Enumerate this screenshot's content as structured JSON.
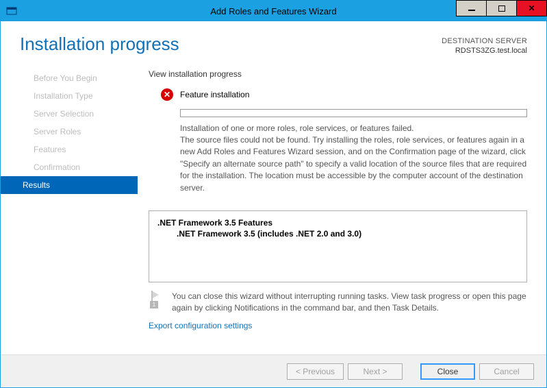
{
  "window": {
    "title": "Add Roles and Features Wizard"
  },
  "header": {
    "page_title": "Installation progress",
    "dest_label": "DESTINATION SERVER",
    "dest_name": "RDSTS3ZG.test.local"
  },
  "sidebar": {
    "items": [
      {
        "label": "Before You Begin"
      },
      {
        "label": "Installation Type"
      },
      {
        "label": "Server Selection"
      },
      {
        "label": "Server Roles"
      },
      {
        "label": "Features"
      },
      {
        "label": "Confirmation"
      },
      {
        "label": "Results"
      }
    ],
    "selected_index": 6
  },
  "main": {
    "section_title": "View installation progress",
    "status_text": "Feature installation",
    "message_line1": "Installation of one or more roles, role services, or features failed.",
    "message_body": "The source files could not be found. Try installing the roles, role services, or features again in a new Add Roles and Features Wizard session, and on the Confirmation page of the wizard, click \"Specify an alternate source path\" to specify a valid location of the source files that are required for the installation. The location must be accessible by the computer account of the destination server.",
    "feature_parent": ".NET Framework 3.5 Features",
    "feature_child": ".NET Framework 3.5 (includes .NET 2.0 and 3.0)",
    "info_text": "You can close this wizard without interrupting running tasks. View task progress or open this page again by clicking Notifications in the command bar, and then Task Details.",
    "export_link": "Export configuration settings",
    "flag_badge": "1"
  },
  "footer": {
    "previous": "< Previous",
    "next": "Next >",
    "close": "Close",
    "cancel": "Cancel"
  }
}
